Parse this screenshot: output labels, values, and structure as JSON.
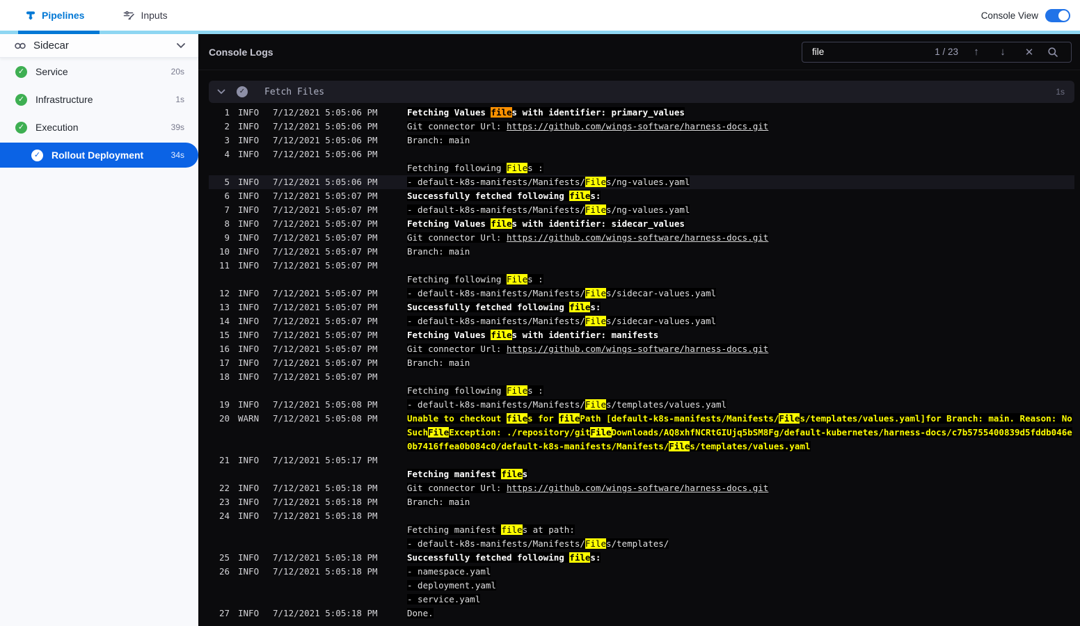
{
  "topbar": {
    "tabs": [
      {
        "label": "Pipelines",
        "active": true
      },
      {
        "label": "Inputs",
        "active": false
      }
    ],
    "console_view_label": "Console View",
    "console_view_on": true
  },
  "sidebar": {
    "title": "Sidecar",
    "items": [
      {
        "label": "Service",
        "duration": "20s",
        "status": "success",
        "selected": false
      },
      {
        "label": "Infrastructure",
        "duration": "1s",
        "status": "success",
        "selected": false
      },
      {
        "label": "Execution",
        "duration": "39s",
        "status": "success",
        "selected": false
      },
      {
        "label": "Rollout Deployment",
        "duration": "34s",
        "status": "success",
        "selected": true
      }
    ]
  },
  "console": {
    "title": "Console Logs",
    "search": {
      "value": "file",
      "counter": "1 / 23"
    },
    "section": {
      "title": "Fetch Files",
      "duration": "1s"
    }
  },
  "colors": {
    "accent_blue": "#0278d5",
    "selected_blue": "#0b63e5",
    "teal_strip": "#8ed6f2",
    "success_green": "#3eaf52",
    "match_highlight": "#ffff00",
    "current_match_highlight": "#ff9100",
    "warn_text": "#ffff00",
    "console_bg": "#0b0b0d"
  },
  "log": {
    "lines": [
      {
        "n": "1",
        "lvl": "INFO",
        "time": "7/12/2021 5:05:06 PM",
        "rows": [
          [
            {
              "t": "Fetching Values ",
              "s": "b"
            },
            {
              "t": "file",
              "s": "ob"
            },
            {
              "t": "s with identifier: primary_values",
              "s": "b"
            }
          ]
        ]
      },
      {
        "n": "2",
        "lvl": "INFO",
        "time": "7/12/2021 5:05:06 PM",
        "rows": [
          [
            {
              "t": "Git connector Url: "
            },
            {
              "t": "https://github.com/wings-software/harness-docs.git",
              "s": "l"
            }
          ]
        ]
      },
      {
        "n": "3",
        "lvl": "INFO",
        "time": "7/12/2021 5:05:06 PM",
        "rows": [
          [
            {
              "t": "Branch: main"
            }
          ]
        ]
      },
      {
        "n": "4",
        "lvl": "INFO",
        "time": "7/12/2021 5:05:06 PM",
        "rows": [
          [],
          [
            {
              "t": "Fetching following "
            },
            {
              "t": "File",
              "s": "y"
            },
            {
              "t": "s :"
            }
          ]
        ]
      },
      {
        "n": "5",
        "lvl": "INFO",
        "time": "7/12/2021 5:05:06 PM",
        "sel": true,
        "rows": [
          [
            {
              "t": "- default-k8s-manifests/Manifests/"
            },
            {
              "t": "File",
              "s": "y"
            },
            {
              "t": "s/ng-values.yaml"
            }
          ]
        ]
      },
      {
        "n": "6",
        "lvl": "INFO",
        "time": "7/12/2021 5:05:07 PM",
        "rows": [
          [
            {
              "t": "Successfully fetched following ",
              "s": "b"
            },
            {
              "t": "file",
              "s": "yb"
            },
            {
              "t": "s:",
              "s": "b"
            }
          ]
        ]
      },
      {
        "n": "7",
        "lvl": "INFO",
        "time": "7/12/2021 5:05:07 PM",
        "rows": [
          [
            {
              "t": "- default-k8s-manifests/Manifests/"
            },
            {
              "t": "File",
              "s": "y"
            },
            {
              "t": "s/ng-values.yaml"
            }
          ]
        ]
      },
      {
        "n": "8",
        "lvl": "INFO",
        "time": "7/12/2021 5:05:07 PM",
        "rows": [
          [
            {
              "t": "Fetching Values ",
              "s": "b"
            },
            {
              "t": "file",
              "s": "yb"
            },
            {
              "t": "s with identifier: sidecar_values",
              "s": "b"
            }
          ]
        ]
      },
      {
        "n": "9",
        "lvl": "INFO",
        "time": "7/12/2021 5:05:07 PM",
        "rows": [
          [
            {
              "t": "Git connector Url: "
            },
            {
              "t": "https://github.com/wings-software/harness-docs.git",
              "s": "l"
            }
          ]
        ]
      },
      {
        "n": "10",
        "lvl": "INFO",
        "time": "7/12/2021 5:05:07 PM",
        "rows": [
          [
            {
              "t": "Branch: main"
            }
          ]
        ]
      },
      {
        "n": "11",
        "lvl": "INFO",
        "time": "7/12/2021 5:05:07 PM",
        "rows": [
          [],
          [
            {
              "t": "Fetching following "
            },
            {
              "t": "File",
              "s": "y"
            },
            {
              "t": "s :"
            }
          ]
        ]
      },
      {
        "n": "12",
        "lvl": "INFO",
        "time": "7/12/2021 5:05:07 PM",
        "rows": [
          [
            {
              "t": "- default-k8s-manifests/Manifests/"
            },
            {
              "t": "File",
              "s": "y"
            },
            {
              "t": "s/sidecar-values.yaml"
            }
          ]
        ]
      },
      {
        "n": "13",
        "lvl": "INFO",
        "time": "7/12/2021 5:05:07 PM",
        "rows": [
          [
            {
              "t": "Successfully fetched following ",
              "s": "b"
            },
            {
              "t": "file",
              "s": "yb"
            },
            {
              "t": "s:",
              "s": "b"
            }
          ]
        ]
      },
      {
        "n": "14",
        "lvl": "INFO",
        "time": "7/12/2021 5:05:07 PM",
        "rows": [
          [
            {
              "t": "- default-k8s-manifests/Manifests/"
            },
            {
              "t": "File",
              "s": "y"
            },
            {
              "t": "s/sidecar-values.yaml"
            }
          ]
        ]
      },
      {
        "n": "15",
        "lvl": "INFO",
        "time": "7/12/2021 5:05:07 PM",
        "rows": [
          [
            {
              "t": "Fetching Values ",
              "s": "b"
            },
            {
              "t": "file",
              "s": "yb"
            },
            {
              "t": "s with identifier: manifests",
              "s": "b"
            }
          ]
        ]
      },
      {
        "n": "16",
        "lvl": "INFO",
        "time": "7/12/2021 5:05:07 PM",
        "rows": [
          [
            {
              "t": "Git connector Url: "
            },
            {
              "t": "https://github.com/wings-software/harness-docs.git",
              "s": "l"
            }
          ]
        ]
      },
      {
        "n": "17",
        "lvl": "INFO",
        "time": "7/12/2021 5:05:07 PM",
        "rows": [
          [
            {
              "t": "Branch: main"
            }
          ]
        ]
      },
      {
        "n": "18",
        "lvl": "INFO",
        "time": "7/12/2021 5:05:07 PM",
        "rows": [
          [],
          [
            {
              "t": "Fetching following "
            },
            {
              "t": "File",
              "s": "y"
            },
            {
              "t": "s :"
            }
          ]
        ]
      },
      {
        "n": "19",
        "lvl": "INFO",
        "time": "7/12/2021 5:05:08 PM",
        "rows": [
          [
            {
              "t": "- default-k8s-manifests/Manifests/"
            },
            {
              "t": "File",
              "s": "y"
            },
            {
              "t": "s/templates/values.yaml"
            }
          ]
        ]
      },
      {
        "n": "20",
        "lvl": "WARN",
        "time": "7/12/2021 5:05:08 PM",
        "warn": true,
        "rows": [
          [
            {
              "t": "Unable to checkout "
            },
            {
              "t": "file",
              "s": "y"
            },
            {
              "t": "s for "
            },
            {
              "t": "file",
              "s": "y"
            },
            {
              "t": "Path [default-k8s-manifests/Manifests/"
            },
            {
              "t": "File",
              "s": "y"
            },
            {
              "t": "s/templates/values.yaml]for Branch: main. Reason: NoSuch"
            },
            {
              "t": "File",
              "s": "y"
            },
            {
              "t": "Exception: ./repository/git"
            },
            {
              "t": "File",
              "s": "y"
            },
            {
              "t": "Downloads/AQ8xhfNCRtGIUjq5bSM8Fg/default-kubernetes/harness-docs/c7b5755400839d5fddb046e0b7416ffea0b084c0/default-k8s-manifests/Manifests/"
            },
            {
              "t": "File",
              "s": "y"
            },
            {
              "t": "s/templates/values.yaml"
            }
          ]
        ]
      },
      {
        "n": "21",
        "lvl": "INFO",
        "time": "7/12/2021 5:05:17 PM",
        "rows": [
          [],
          [
            {
              "t": "Fetching manifest ",
              "s": "b"
            },
            {
              "t": "file",
              "s": "yb"
            },
            {
              "t": "s",
              "s": "b"
            }
          ]
        ]
      },
      {
        "n": "22",
        "lvl": "INFO",
        "time": "7/12/2021 5:05:18 PM",
        "rows": [
          [
            {
              "t": "Git connector Url: "
            },
            {
              "t": "https://github.com/wings-software/harness-docs.git",
              "s": "l"
            }
          ]
        ]
      },
      {
        "n": "23",
        "lvl": "INFO",
        "time": "7/12/2021 5:05:18 PM",
        "rows": [
          [
            {
              "t": "Branch: main"
            }
          ]
        ]
      },
      {
        "n": "24",
        "lvl": "INFO",
        "time": "7/12/2021 5:05:18 PM",
        "rows": [
          [],
          [
            {
              "t": "Fetching manifest "
            },
            {
              "t": "file",
              "s": "y"
            },
            {
              "t": "s at path:"
            }
          ],
          [
            {
              "t": "- default-k8s-manifests/Manifests/"
            },
            {
              "t": "File",
              "s": "y"
            },
            {
              "t": "s/templates/"
            }
          ]
        ]
      },
      {
        "n": "25",
        "lvl": "INFO",
        "time": "7/12/2021 5:05:18 PM",
        "rows": [
          [
            {
              "t": "Successfully fetched following ",
              "s": "b"
            },
            {
              "t": "file",
              "s": "yb"
            },
            {
              "t": "s:",
              "s": "b"
            }
          ]
        ]
      },
      {
        "n": "26",
        "lvl": "INFO",
        "time": "7/12/2021 5:05:18 PM",
        "rows": [
          [
            {
              "t": "- namespace.yaml"
            }
          ],
          [
            {
              "t": "- deployment.yaml"
            }
          ],
          [
            {
              "t": "- service.yaml"
            }
          ]
        ]
      },
      {
        "n": "27",
        "lvl": "INFO",
        "time": "7/12/2021 5:05:18 PM",
        "rows": [
          [
            {
              "t": "Done."
            }
          ]
        ]
      }
    ]
  }
}
